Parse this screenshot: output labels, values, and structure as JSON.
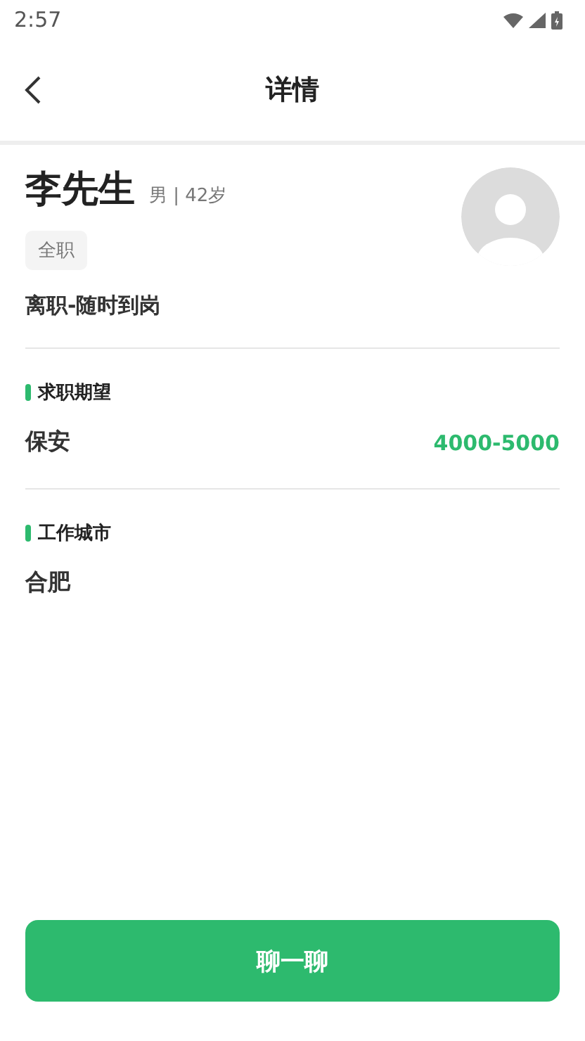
{
  "status_bar": {
    "time": "2:57"
  },
  "header": {
    "title": "详情"
  },
  "profile": {
    "name": "李先生",
    "meta": "男 | 42岁",
    "tag": "全职",
    "availability": "离职-随时到岗"
  },
  "sections": [
    {
      "title": "求职期望",
      "value": "保安",
      "extra": "4000-5000"
    },
    {
      "title": "工作城市",
      "value": "合肥"
    }
  ],
  "action_button": {
    "label": "聊一聊"
  }
}
